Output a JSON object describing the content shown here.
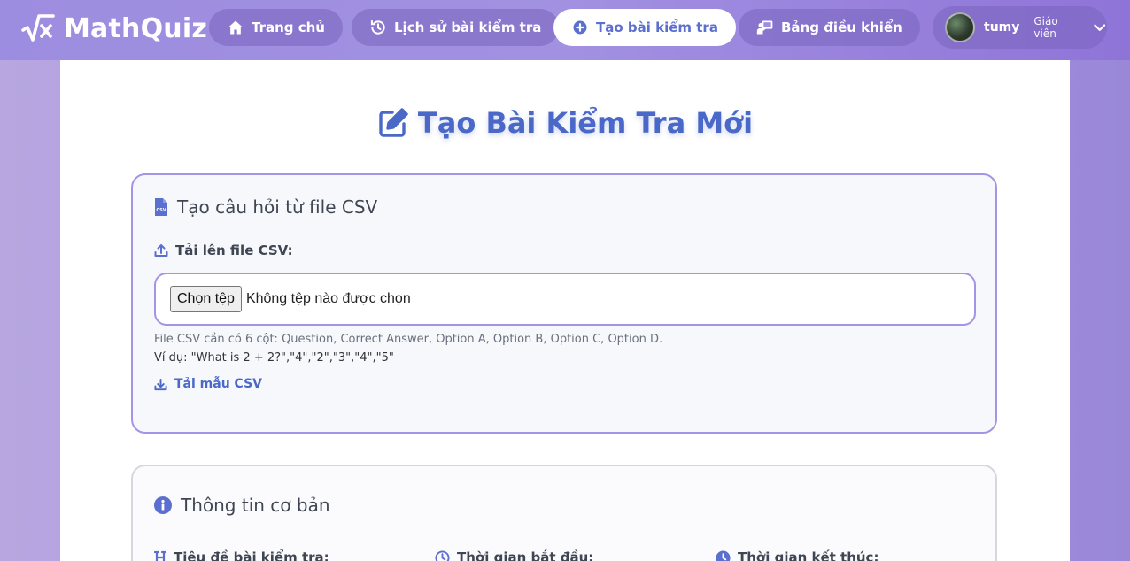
{
  "app": {
    "logo_text": "MathQuiz"
  },
  "nav": [
    {
      "label": "Trang chủ",
      "icon": "home-icon"
    },
    {
      "label": "Lịch sử bài kiểm tra",
      "icon": "history-icon"
    },
    {
      "label": "Tạo bài kiểm tra",
      "icon": "plus-circle-icon",
      "active": true
    },
    {
      "label": "Bảng điều khiển",
      "icon": "teacher-board-icon"
    }
  ],
  "user": {
    "name": "tumy",
    "role": "Giáo viên"
  },
  "page": {
    "title": "Tạo Bài Kiểm Tra Mới"
  },
  "csv_section": {
    "heading": "Tạo câu hỏi từ file CSV",
    "upload_label": "Tải lên file CSV:",
    "file_button": "Chọn tệp",
    "file_status": "Không tệp nào được chọn",
    "hint": "File CSV cần có 6 cột: Question, Correct Answer, Option A, Option B, Option C, Option D.",
    "example": "Ví dụ: \"What is 2 + 2?\",\"4\",\"2\",\"3\",\"4\",\"5\"",
    "download_label": "Tải mẫu CSV"
  },
  "basic_section": {
    "heading": "Thông tin cơ bản",
    "fields": [
      {
        "label": "Tiêu đề bài kiểm tra:",
        "icon": "heading-icon"
      },
      {
        "label": "Thời gian bắt đầu:",
        "icon": "clock-outline-icon"
      },
      {
        "label": "Thời gian kết thúc:",
        "icon": "clock-solid-icon"
      }
    ]
  },
  "colors": {
    "accent": "#4a68c8",
    "border_purple": "#a493e6",
    "header": "#a291e1"
  }
}
